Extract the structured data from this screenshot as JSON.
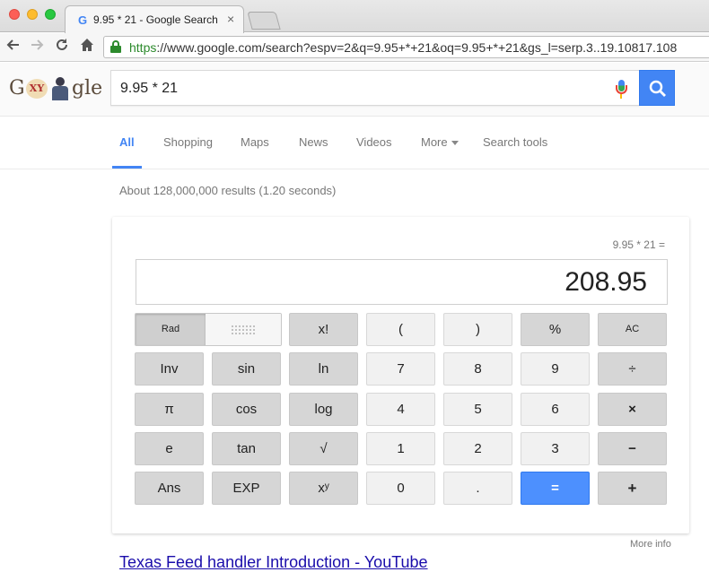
{
  "browser": {
    "tab_favicon": "G",
    "tab_title": "9.95 * 21 - Google Search",
    "tab_close": "×",
    "url_scheme": "https",
    "url_rest": "://www.google.com/search?espv=2&q=9.95+*+21&oq=9.95+*+21&gs_l=serp.3..19.10817.108"
  },
  "google": {
    "logo_letters_start": "G",
    "logo_letters_mid": "XY",
    "logo_letters_end": "gle",
    "search_query": "9.95 * 21"
  },
  "tabs": [
    {
      "label": "All",
      "active": true
    },
    {
      "label": "Shopping"
    },
    {
      "label": "Maps"
    },
    {
      "label": "News"
    },
    {
      "label": "Videos"
    },
    {
      "label": "More"
    },
    {
      "label": "Search tools"
    }
  ],
  "stats": "About 128,000,000 results (1.20 seconds)",
  "calculator": {
    "expression": "9.95 * 21 =",
    "result": "208.95",
    "rad_label": "Rad",
    "keys": {
      "fact": "x!",
      "lparen": "(",
      "rparen": ")",
      "percent": "%",
      "ac": "AC",
      "inv": "Inv",
      "sin": "sin",
      "ln": "ln",
      "seven": "7",
      "eight": "8",
      "nine": "9",
      "divide": "÷",
      "pi": "π",
      "cos": "cos",
      "log": "log",
      "four": "4",
      "five": "5",
      "six": "6",
      "multiply": "×",
      "e": "e",
      "tan": "tan",
      "sqrt": "√",
      "one": "1",
      "two": "2",
      "three": "3",
      "minus": "−",
      "ans": "Ans",
      "exp": "EXP",
      "power": "xʸ",
      "zero": "0",
      "dot": ".",
      "equals": "=",
      "plus": "+"
    }
  },
  "more_info": "More info",
  "next_result_title": "Texas Feed handler Introduction - YouTube"
}
